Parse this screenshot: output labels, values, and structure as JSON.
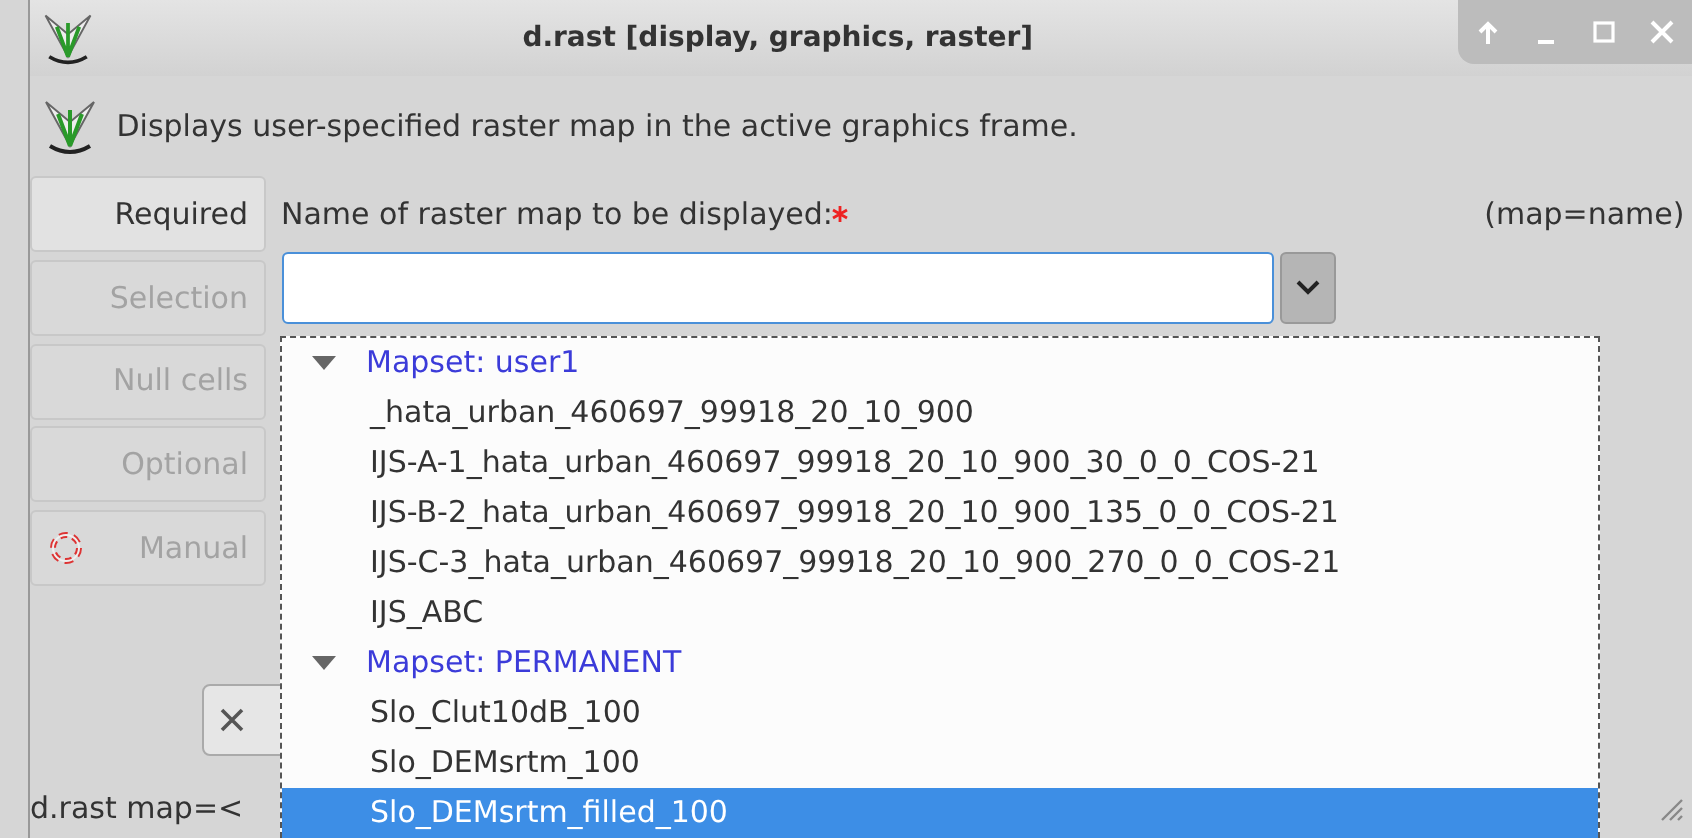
{
  "window": {
    "title": "d.rast [display, graphics, raster]"
  },
  "description": "Displays user-specified raster map in the active graphics frame.",
  "tabs": [
    {
      "label": "Required",
      "selected": true,
      "kind": "page"
    },
    {
      "label": "Selection",
      "selected": false,
      "kind": "page"
    },
    {
      "label": "Null cells",
      "selected": false,
      "kind": "page"
    },
    {
      "label": "Optional",
      "selected": false,
      "kind": "page"
    },
    {
      "label": "Manual",
      "selected": false,
      "kind": "manual"
    }
  ],
  "field": {
    "label": "Name of raster map to be displayed:",
    "required": true,
    "key": "(map=name)"
  },
  "dropdown": {
    "groups": [
      {
        "label": "Mapset: user1",
        "expanded": true,
        "children": [
          {
            "label": "_hata_urban_460697_99918_20_10_900",
            "selected": false
          },
          {
            "label": "IJS-A-1_hata_urban_460697_99918_20_10_900_30_0_0_COS-21",
            "selected": false
          },
          {
            "label": "IJS-B-2_hata_urban_460697_99918_20_10_900_135_0_0_COS-21",
            "selected": false
          },
          {
            "label": "IJS-C-3_hata_urban_460697_99918_20_10_900_270_0_0_COS-21",
            "selected": false
          },
          {
            "label": "IJS_ABC",
            "selected": false
          }
        ]
      },
      {
        "label": "Mapset: PERMANENT",
        "expanded": true,
        "children": [
          {
            "label": "Slo_Clut10dB_100",
            "selected": false
          },
          {
            "label": "Slo_DEMsrtm_100",
            "selected": false
          },
          {
            "label": "Slo_DEMsrtm_filled_100",
            "selected": true
          }
        ]
      }
    ]
  },
  "status_bar": "d.rast map=<"
}
